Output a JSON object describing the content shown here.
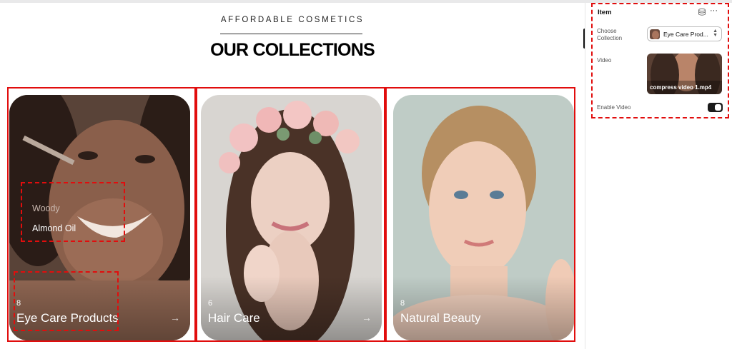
{
  "section": {
    "eyebrow": "AFFORDABLE COSMETICS",
    "heading": "OUR COLLECTIONS"
  },
  "cards": [
    {
      "count": "8",
      "title": "Eye Care Products",
      "arrow": "→"
    },
    {
      "count": "6",
      "title": "Hair Care",
      "arrow": "→"
    },
    {
      "count": "8",
      "title": "Natural Beauty",
      "arrow": ""
    }
  ],
  "hotspot": {
    "brand": "Woody",
    "product": "Almond Oil"
  },
  "panel": {
    "title": "Item",
    "more": "···",
    "collection_label": "Choose Collection",
    "collection_value": "Eye Care Prod...",
    "video_label": "Video",
    "video_file": "compress video 1.mp4",
    "enable_label": "Enable Video",
    "enable_on": true
  },
  "colors": {
    "highlight": "#e10d0d",
    "toggle": "#1a1a1a"
  },
  "icons": [
    "database-icon",
    "more-icon",
    "chevron-updown-icon",
    "arrow-right-icon"
  ]
}
